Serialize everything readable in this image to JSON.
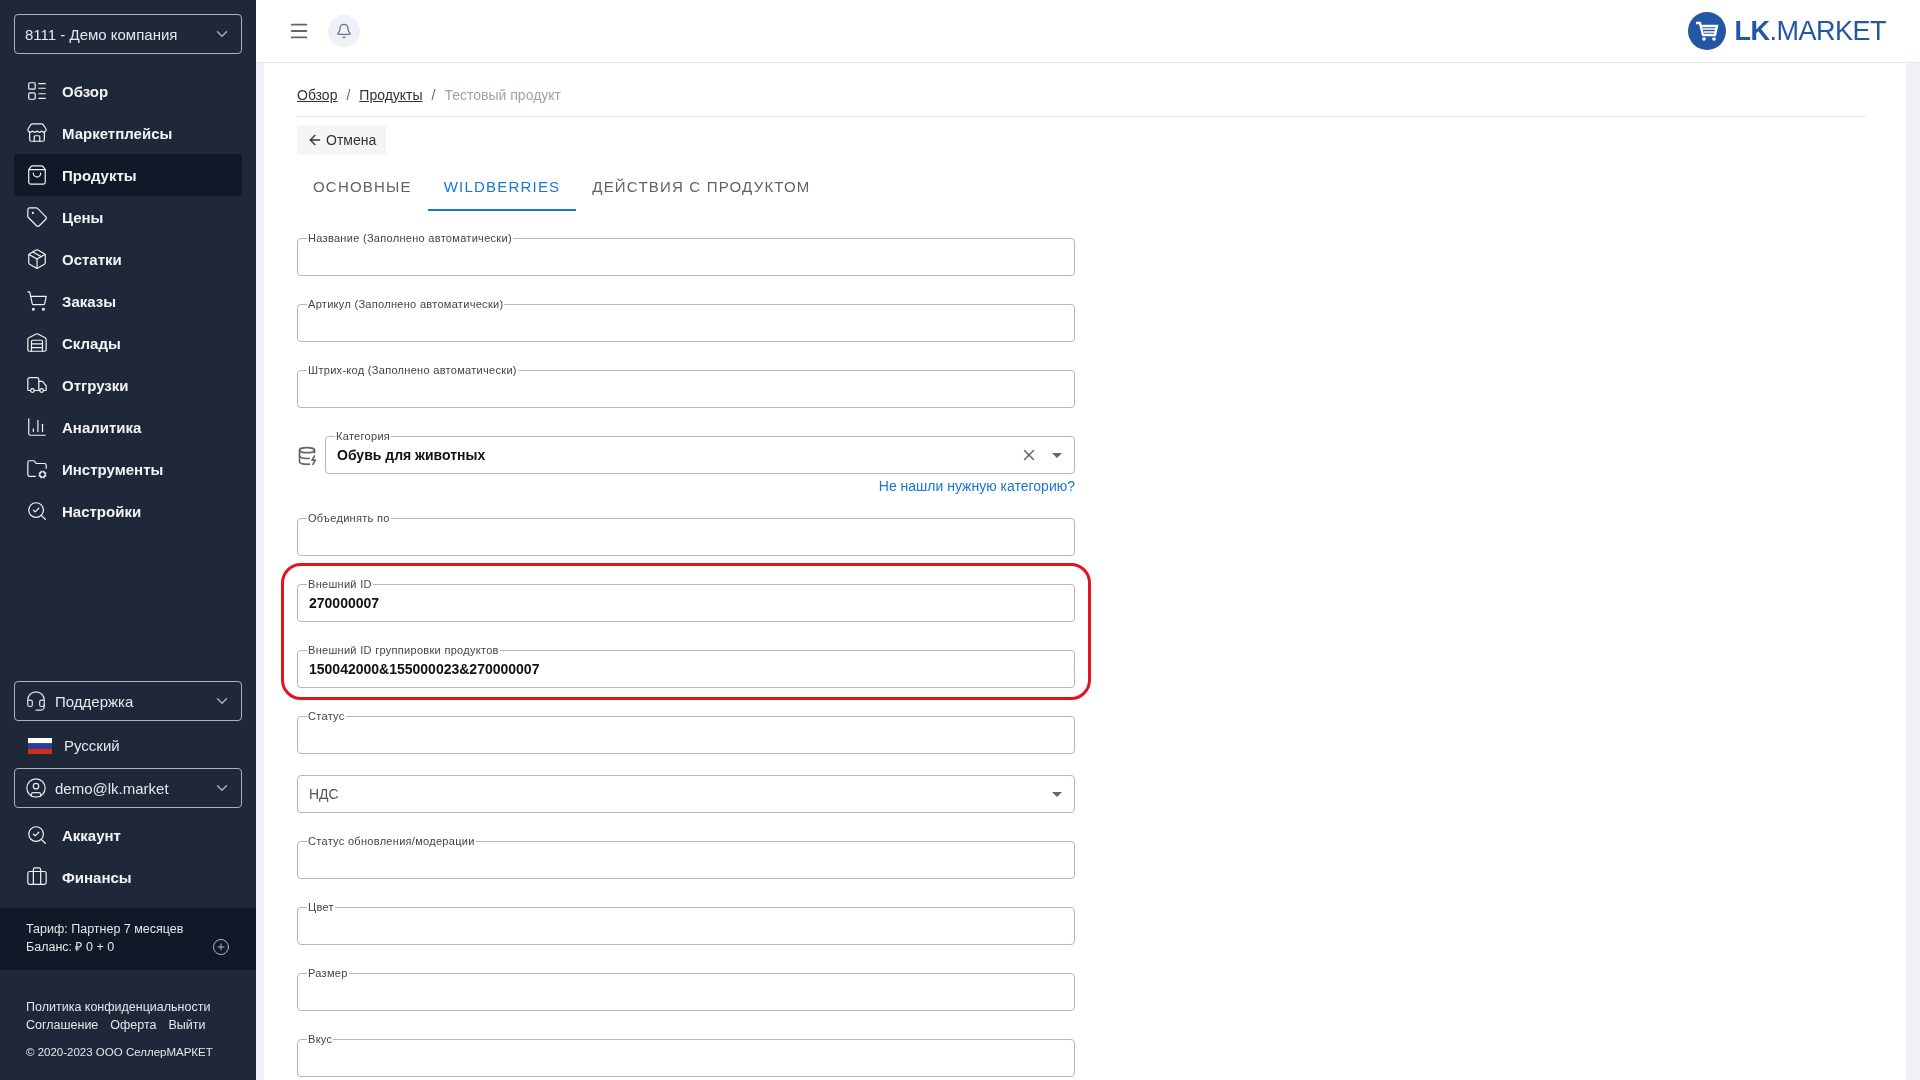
{
  "sidebar": {
    "company_select": {
      "value": "8111 - Демо компания"
    },
    "nav": [
      {
        "label": "Обзор",
        "selected": false
      },
      {
        "label": "Маркетплейсы",
        "selected": false
      },
      {
        "label": "Продукты",
        "selected": true
      },
      {
        "label": "Цены",
        "selected": false
      },
      {
        "label": "Остатки",
        "selected": false
      },
      {
        "label": "Заказы",
        "selected": false
      },
      {
        "label": "Склады",
        "selected": false
      },
      {
        "label": "Отгрузки",
        "selected": false
      },
      {
        "label": "Аналитика",
        "selected": false
      },
      {
        "label": "Инструменты",
        "selected": false
      },
      {
        "label": "Настройки",
        "selected": false
      }
    ],
    "support_select": {
      "value": "Поддержка"
    },
    "language": {
      "label": "Русский"
    },
    "user_select": {
      "value": "demo@lk.market"
    },
    "account_nav": [
      {
        "label": "Аккаунт",
        "selected": false
      },
      {
        "label": "Финансы",
        "selected": false
      }
    ],
    "tariff": {
      "plan": "Тариф: Партнер 7 месяцев",
      "balance": "Баланс: ₽ 0 + 0"
    },
    "footer_links": [
      [
        "Политика конфиденциальности"
      ],
      [
        "Соглашение",
        "Оферта",
        "Выйти"
      ]
    ],
    "copyright": "© 2020-2023 ООО СеллерМАРКЕТ"
  },
  "header": {
    "logo": "**LK**.MARKET"
  },
  "breadcrumb_separator": "/",
  "breadcrumbs": [
    {
      "label": "Обзор",
      "kind": "link"
    },
    {
      "label": "Продукты",
      "kind": "link"
    },
    {
      "label": "Тестовый продукт",
      "kind": "current"
    }
  ],
  "back_button": "Отмена",
  "tabs": [
    {
      "label": "ОСНОВНЫЕ",
      "selected": false
    },
    {
      "label": "WILDBERRIES",
      "selected": true
    },
    {
      "label": "ДЕЙСТВИЯ С ПРОДУКТОМ",
      "selected": false
    }
  ],
  "form": [
    {
      "kind": "text",
      "label": "Название (Заполнено автоматически)"
    },
    {
      "kind": "text",
      "label": "Артикул (Заполнено автоматически)"
    },
    {
      "kind": "text",
      "label": "Штрих-код (Заполнено автоматически)"
    },
    {
      "kind": "autocomplete",
      "label": "Категория",
      "value": "Обувь для животных",
      "helper_link": "Не нашли нужную категорию?"
    },
    {
      "kind": "text",
      "label": "Объединять по"
    },
    {
      "kind": "highlight",
      "fields": [
        {
          "kind": "text",
          "label": "Внешний ID",
          "value": "270000007"
        },
        {
          "kind": "text",
          "label": "Внешний ID группировки продуктов",
          "value": "150042000&155000023&270000007"
        }
      ]
    },
    {
      "kind": "text",
      "label": "Статус"
    },
    {
      "kind": "select",
      "placeholder": "НДС"
    },
    {
      "kind": "text",
      "label": "Статус обновления/модерации"
    },
    {
      "kind": "text",
      "label": "Цвет"
    },
    {
      "kind": "text",
      "label": "Размер"
    },
    {
      "kind": "text",
      "label": "Вкус"
    }
  ]
}
